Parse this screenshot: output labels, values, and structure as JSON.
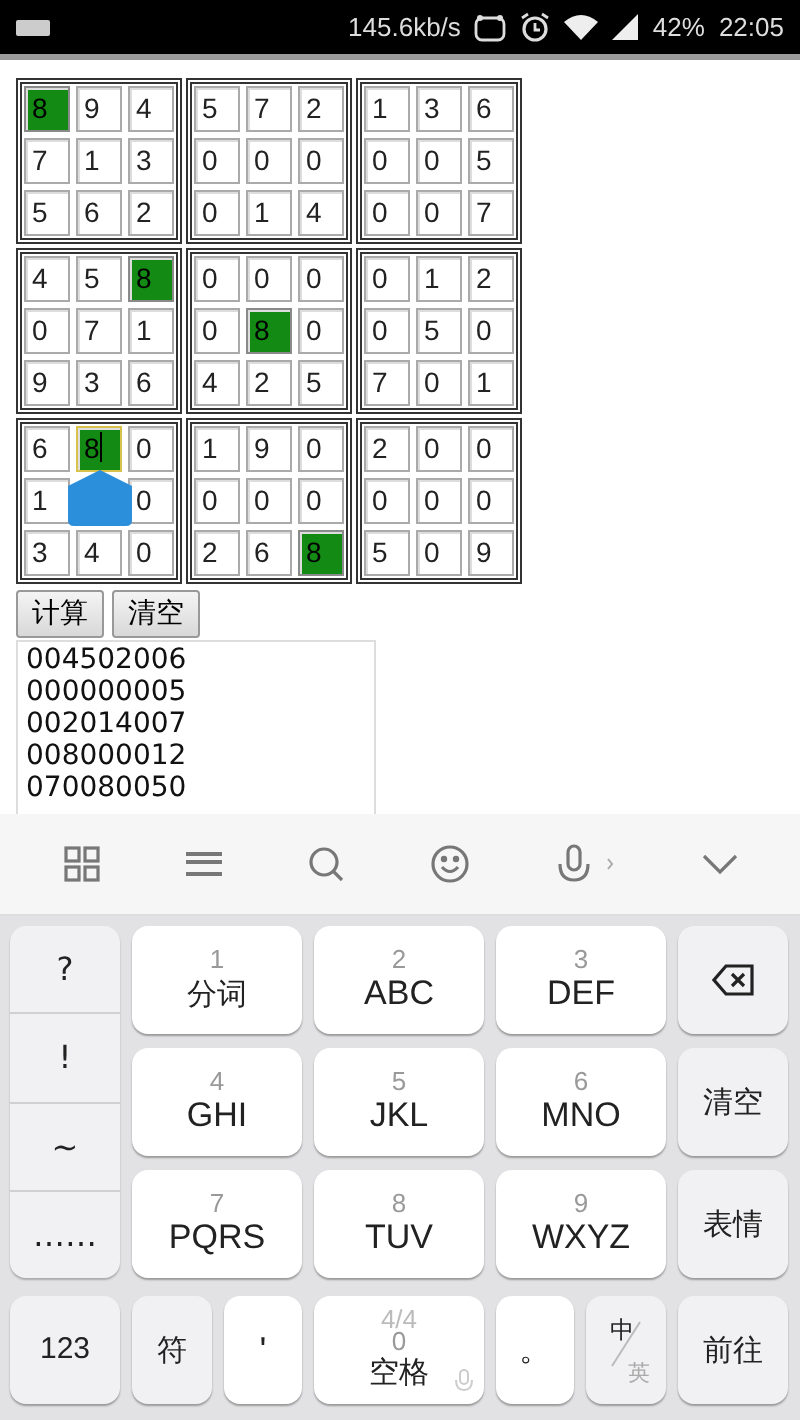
{
  "status_bar": {
    "speed": "145.6kb/s",
    "battery": "42%",
    "time": "22:05"
  },
  "sudoku": {
    "rows": [
      [
        {
          "value": "8",
          "highlighted": true,
          "focused": false
        },
        {
          "value": "9",
          "highlighted": false,
          "focused": false
        },
        {
          "value": "4",
          "highlighted": false,
          "focused": false
        },
        {
          "value": "5",
          "highlighted": false,
          "focused": false
        },
        {
          "value": "7",
          "highlighted": false,
          "focused": false
        },
        {
          "value": "2",
          "highlighted": false,
          "focused": false
        },
        {
          "value": "1",
          "highlighted": false,
          "focused": false
        },
        {
          "value": "3",
          "highlighted": false,
          "focused": false
        },
        {
          "value": "6",
          "highlighted": false,
          "focused": false
        }
      ],
      [
        {
          "value": "7",
          "highlighted": false,
          "focused": false
        },
        {
          "value": "1",
          "highlighted": false,
          "focused": false
        },
        {
          "value": "3",
          "highlighted": false,
          "focused": false
        },
        {
          "value": "0",
          "highlighted": false,
          "focused": false
        },
        {
          "value": "0",
          "highlighted": false,
          "focused": false
        },
        {
          "value": "0",
          "highlighted": false,
          "focused": false
        },
        {
          "value": "0",
          "highlighted": false,
          "focused": false
        },
        {
          "value": "0",
          "highlighted": false,
          "focused": false
        },
        {
          "value": "5",
          "highlighted": false,
          "focused": false
        }
      ],
      [
        {
          "value": "5",
          "highlighted": false,
          "focused": false
        },
        {
          "value": "6",
          "highlighted": false,
          "focused": false
        },
        {
          "value": "2",
          "highlighted": false,
          "focused": false
        },
        {
          "value": "0",
          "highlighted": false,
          "focused": false
        },
        {
          "value": "1",
          "highlighted": false,
          "focused": false
        },
        {
          "value": "4",
          "highlighted": false,
          "focused": false
        },
        {
          "value": "0",
          "highlighted": false,
          "focused": false
        },
        {
          "value": "0",
          "highlighted": false,
          "focused": false
        },
        {
          "value": "7",
          "highlighted": false,
          "focused": false
        }
      ],
      [
        {
          "value": "4",
          "highlighted": false,
          "focused": false
        },
        {
          "value": "5",
          "highlighted": false,
          "focused": false
        },
        {
          "value": "8",
          "highlighted": true,
          "focused": false
        },
        {
          "value": "0",
          "highlighted": false,
          "focused": false
        },
        {
          "value": "0",
          "highlighted": false,
          "focused": false
        },
        {
          "value": "0",
          "highlighted": false,
          "focused": false
        },
        {
          "value": "0",
          "highlighted": false,
          "focused": false
        },
        {
          "value": "1",
          "highlighted": false,
          "focused": false
        },
        {
          "value": "2",
          "highlighted": false,
          "focused": false
        }
      ],
      [
        {
          "value": "0",
          "highlighted": false,
          "focused": false
        },
        {
          "value": "7",
          "highlighted": false,
          "focused": false
        },
        {
          "value": "1",
          "highlighted": false,
          "focused": false
        },
        {
          "value": "0",
          "highlighted": false,
          "focused": false
        },
        {
          "value": "8",
          "highlighted": true,
          "focused": false
        },
        {
          "value": "0",
          "highlighted": false,
          "focused": false
        },
        {
          "value": "0",
          "highlighted": false,
          "focused": false
        },
        {
          "value": "5",
          "highlighted": false,
          "focused": false
        },
        {
          "value": "0",
          "highlighted": false,
          "focused": false
        }
      ],
      [
        {
          "value": "9",
          "highlighted": false,
          "focused": false
        },
        {
          "value": "3",
          "highlighted": false,
          "focused": false
        },
        {
          "value": "6",
          "highlighted": false,
          "focused": false
        },
        {
          "value": "4",
          "highlighted": false,
          "focused": false
        },
        {
          "value": "2",
          "highlighted": false,
          "focused": false
        },
        {
          "value": "5",
          "highlighted": false,
          "focused": false
        },
        {
          "value": "7",
          "highlighted": false,
          "focused": false
        },
        {
          "value": "0",
          "highlighted": false,
          "focused": false
        },
        {
          "value": "1",
          "highlighted": false,
          "focused": false
        }
      ],
      [
        {
          "value": "6",
          "highlighted": false,
          "focused": false
        },
        {
          "value": "8",
          "highlighted": true,
          "focused": true
        },
        {
          "value": "0",
          "highlighted": false,
          "focused": false
        },
        {
          "value": "1",
          "highlighted": false,
          "focused": false
        },
        {
          "value": "9",
          "highlighted": false,
          "focused": false
        },
        {
          "value": "0",
          "highlighted": false,
          "focused": false
        },
        {
          "value": "2",
          "highlighted": false,
          "focused": false
        },
        {
          "value": "0",
          "highlighted": false,
          "focused": false
        },
        {
          "value": "0",
          "highlighted": false,
          "focused": false
        }
      ],
      [
        {
          "value": "1",
          "highlighted": false,
          "focused": false
        },
        {
          "covered": true
        },
        {
          "value": "0",
          "highlighted": false,
          "focused": false
        },
        {
          "value": "0",
          "highlighted": false,
          "focused": false
        },
        {
          "value": "0",
          "highlighted": false,
          "focused": false
        },
        {
          "value": "0",
          "highlighted": false,
          "focused": false
        },
        {
          "value": "0",
          "highlighted": false,
          "focused": false
        },
        {
          "value": "0",
          "highlighted": false,
          "focused": false
        },
        {
          "value": "0",
          "highlighted": false,
          "focused": false
        }
      ],
      [
        {
          "value": "3",
          "highlighted": false,
          "focused": false
        },
        {
          "value": "4",
          "highlighted": false,
          "focused": false
        },
        {
          "value": "0",
          "highlighted": false,
          "focused": false
        },
        {
          "value": "2",
          "highlighted": false,
          "focused": false
        },
        {
          "value": "6",
          "highlighted": false,
          "focused": false
        },
        {
          "value": "8",
          "highlighted": true,
          "focused": false
        },
        {
          "value": "5",
          "highlighted": false,
          "focused": false
        },
        {
          "value": "0",
          "highlighted": false,
          "focused": false
        },
        {
          "value": "9",
          "highlighted": false,
          "focused": false
        }
      ]
    ]
  },
  "buttons": [
    {
      "label": "计算"
    },
    {
      "label": "清空"
    }
  ],
  "output": {
    "lines": [
      "004502006",
      "000000005",
      "002014007",
      "008000012",
      "070080050"
    ]
  },
  "keyboard": {
    "symbols": [
      "?",
      "!",
      "~",
      "……"
    ],
    "keys": [
      {
        "digit": "1",
        "label": "分词"
      },
      {
        "digit": "2",
        "label": "ABC"
      },
      {
        "digit": "3",
        "label": "DEF"
      },
      {
        "digit": "4",
        "label": "GHI"
      },
      {
        "digit": "5",
        "label": "JKL"
      },
      {
        "digit": "6",
        "label": "MNO"
      },
      {
        "digit": "7",
        "label": "PQRS"
      },
      {
        "digit": "8",
        "label": "TUV"
      },
      {
        "digit": "9",
        "label": "WXYZ"
      }
    ],
    "side_keys": [
      {
        "kind": "backspace"
      },
      {
        "kind": "text",
        "label": "清空"
      },
      {
        "kind": "text",
        "label": "表情"
      }
    ],
    "bottom": {
      "mode": "123",
      "symbols": "符",
      "separator": "'",
      "space": {
        "page": "4/4",
        "digit": "0",
        "label": "空格"
      },
      "period": "。",
      "language": {
        "primary": "中",
        "secondary": "英"
      },
      "enter": "前往"
    }
  }
}
